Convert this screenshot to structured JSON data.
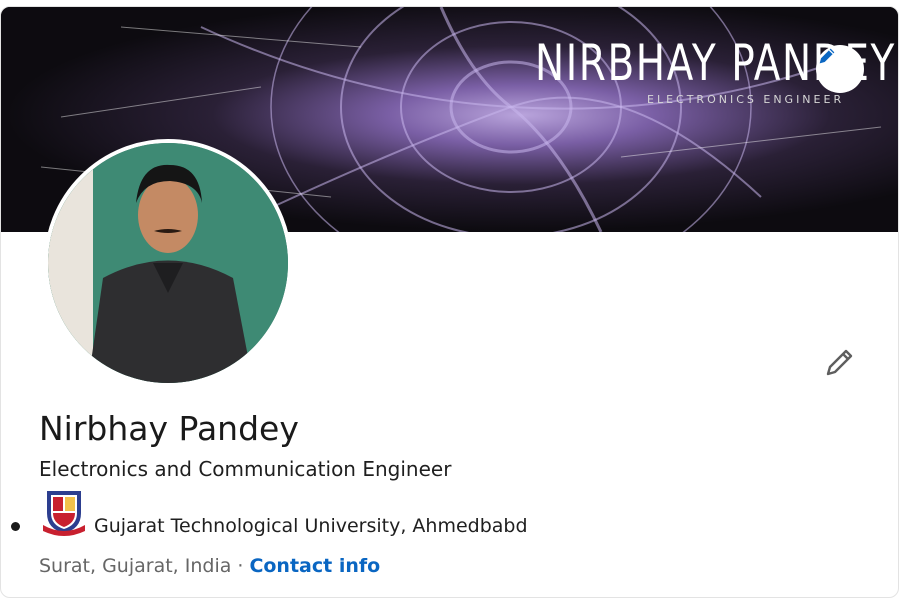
{
  "banner": {
    "title": "NIRBHAY PANDEY",
    "subtitle": "ELECTRONICS ENGINEER",
    "edit_icon": "pencil-icon"
  },
  "profile": {
    "avatar_icon": "profile-photo",
    "edit_icon": "pencil-icon",
    "name": "Nirbhay Pandey",
    "headline": "Electronics and Communication Engineer",
    "education": {
      "logo_icon": "university-crest-icon",
      "school": "Gujarat Technological University, Ahmedbabd"
    },
    "location": "Surat, Gujarat, India",
    "separator": "·",
    "contact_label": "Contact info"
  },
  "colors": {
    "link": "#0a66c2",
    "banner_accent": "#8a6cc0",
    "avatar_background": "#3b7a68"
  }
}
